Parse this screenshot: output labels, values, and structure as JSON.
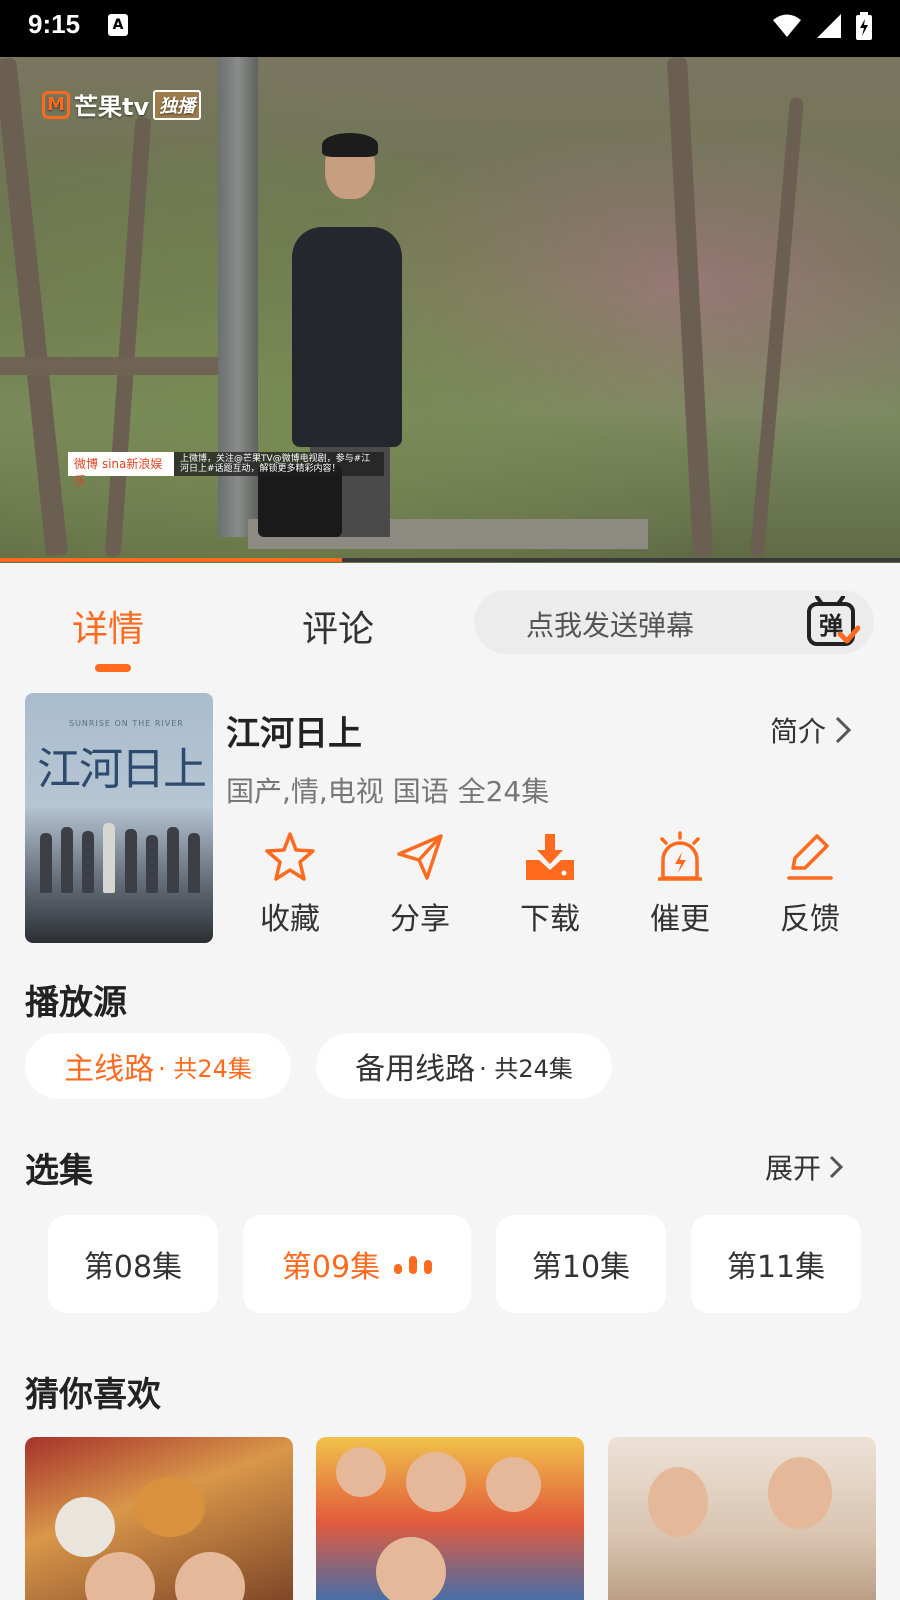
{
  "status_bar": {
    "time": "9:15",
    "notification_icon": "A"
  },
  "video": {
    "brand": "芒果tv",
    "brand_tag": "独播",
    "banner_left": "微博 sina新浪娱乐",
    "banner_text": "上微博，关注@芒果TV@微博电视剧，参与#江河日上#话题互动，解锁更多精彩内容！",
    "progress": 0.38
  },
  "tabs": [
    {
      "label": "详情",
      "active": true
    },
    {
      "label": "评论",
      "active": false
    }
  ],
  "danmu": {
    "placeholder": "点我发送弹幕",
    "icon_text": "弹"
  },
  "show": {
    "poster_title": "江河日上",
    "poster_subtitle": "SUNRISE ON THE RIVER",
    "title": "江河日上",
    "meta": "国产,情,电视 国语 全24集",
    "intro_label": "简介"
  },
  "actions": [
    {
      "label": "收藏",
      "icon": "star-icon"
    },
    {
      "label": "分享",
      "icon": "share-icon"
    },
    {
      "label": "下载",
      "icon": "download-icon"
    },
    {
      "label": "催更",
      "icon": "alarm-icon"
    },
    {
      "label": "反馈",
      "icon": "feedback-icon"
    }
  ],
  "sources": {
    "title": "播放源",
    "items": [
      {
        "name": "主线路",
        "count": " · 共24集",
        "active": true
      },
      {
        "name": "备用线路",
        "count": " · 共24集",
        "active": false
      }
    ]
  },
  "episodes": {
    "title": "选集",
    "expand_label": "展开",
    "items": [
      {
        "label": "第08集",
        "active": false
      },
      {
        "label": "第09集",
        "active": true
      },
      {
        "label": "第10集",
        "active": false
      },
      {
        "label": "第11集",
        "active": false
      }
    ]
  },
  "recommend": {
    "title": "猜你喜欢"
  },
  "colors": {
    "accent": "#ff6a1f",
    "background": "#f5f5f5",
    "text": "#222222"
  }
}
